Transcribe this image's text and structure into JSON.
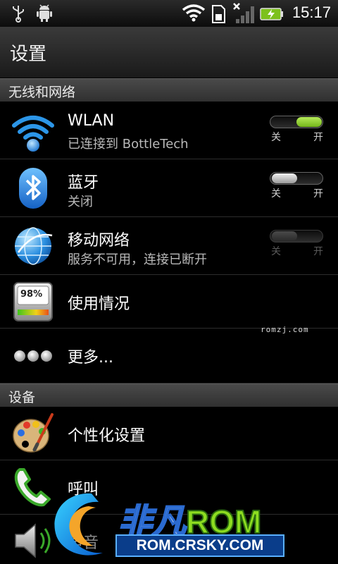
{
  "status_bar": {
    "time": "15:17",
    "icons": [
      "usb-icon",
      "android-debug-icon",
      "wifi-icon",
      "sd-card-icon",
      "no-signal-icon",
      "battery-charging-icon"
    ]
  },
  "header": {
    "title": "设置"
  },
  "sections": {
    "wireless": "无线和网络",
    "device": "设备"
  },
  "items": {
    "wlan": {
      "title": "WLAN",
      "subtitle": "已连接到 BottleTech",
      "toggle_off": "关",
      "toggle_on": "开",
      "state": "on"
    },
    "bluetooth": {
      "title": "蓝牙",
      "subtitle": "关闭",
      "toggle_off": "关",
      "toggle_on": "开",
      "state": "off"
    },
    "mobile_network": {
      "title": "移动网络",
      "subtitle": "服务不可用，连接已断开",
      "toggle_off": "关",
      "toggle_on": "开",
      "state": "disabled"
    },
    "usage": {
      "title": "使用情况",
      "icon_text": "98%"
    },
    "more": {
      "title": "更多..."
    },
    "personalize": {
      "title": "个性化设置"
    },
    "call": {
      "title": "呼叫"
    },
    "sound": {
      "title": "声音"
    }
  },
  "watermark": {
    "small": "romzj.com",
    "brand_cn": "非凡",
    "brand_rom": "ROM",
    "brand_url": "ROM.CRSKY.COM"
  },
  "colors": {
    "toggle_on": "#8fce2b",
    "accent_blue": "#2a8fe0"
  }
}
